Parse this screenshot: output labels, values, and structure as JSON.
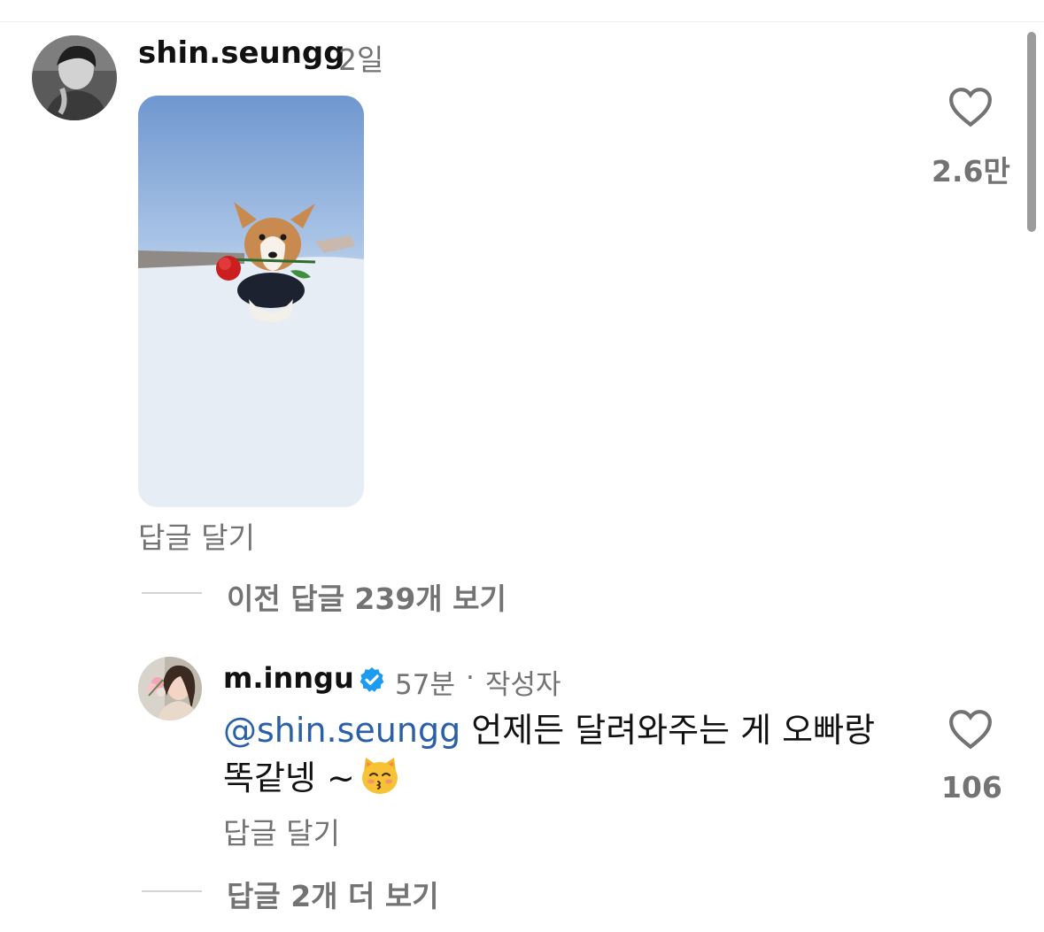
{
  "comment1": {
    "username": "shin.seungg",
    "time": "2일",
    "reply_label": "답글 달기",
    "likes": "2.6만",
    "gif_description_icon": "corgi-with-rose-gif"
  },
  "thread": {
    "view_previous": "이전 답글 239개 보기",
    "view_more": "답글 2개 더 보기"
  },
  "comment2": {
    "username": "m.inngu",
    "verified_icon": "verified-badge-icon",
    "time": "57분",
    "separator": "·",
    "author_badge": "작성자",
    "mention": "@shin.seungg",
    "text_line1": " 언제든 달려와주는 게 오빠랑",
    "text_line2": "똑같넹 ~",
    "emoji": "😽",
    "reply_label": "답글 달기",
    "likes": "106"
  },
  "colors": {
    "text": "#111111",
    "muted": "#737373",
    "mention": "#2b5fa8",
    "verified": "#1d9bf0",
    "divider": "#d4d4d4"
  }
}
